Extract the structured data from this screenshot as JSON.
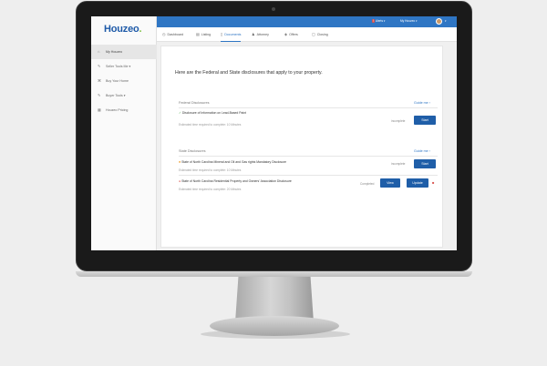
{
  "app": {
    "logo_main": "Houzeo",
    "logo_suffix": "."
  },
  "topbar": {
    "alerts_badge": "!",
    "alerts_label": "Alerts ▾",
    "myhouzeo_label": "My Houzeo ▾",
    "user_caret": "▾"
  },
  "sidebar": {
    "items": [
      {
        "label": "My Houzeo",
        "icon": "home-icon",
        "glyph": "⌂"
      },
      {
        "label": "Seller Tools Me ▾",
        "icon": "tools-icon",
        "glyph": "✎"
      },
      {
        "label": "Buy Your Home",
        "icon": "cart-icon",
        "glyph": "⌘"
      },
      {
        "label": "Buyer Tools ▾",
        "icon": "tools-icon",
        "glyph": "✎"
      },
      {
        "label": "Houzeo Pricing",
        "icon": "grid-icon",
        "glyph": "▦"
      }
    ]
  },
  "tabs": [
    {
      "label": "Dashboard",
      "glyph": "◷",
      "icon": "dashboard-icon"
    },
    {
      "label": "Listing",
      "glyph": "▤",
      "icon": "listing-icon"
    },
    {
      "label": "Documents",
      "glyph": "▯",
      "icon": "document-icon"
    },
    {
      "label": "Attorney",
      "glyph": "♟",
      "icon": "attorney-icon"
    },
    {
      "label": "Offers",
      "glyph": "◈",
      "icon": "offers-icon"
    },
    {
      "label": "Closing",
      "glyph": "▢",
      "icon": "closing-icon"
    }
  ],
  "main": {
    "heading": "Here are the Federal and State disclosures that apply to your property.",
    "federal": {
      "title": "Federal Disclosures",
      "guide": "Guide me ›",
      "docs": [
        {
          "name": "Disclosure of Information on Lead-Based Paint",
          "mark": "✓",
          "mark_color": "#5cb85c",
          "estimate": "Estimated time required to complete: 10 Minutes",
          "status": "incomplete",
          "button": "Start"
        }
      ]
    },
    "state": {
      "title": "State Disclosures",
      "guide": "Guide me ›",
      "docs": [
        {
          "name": "State of North Carolina Mineral and Oil and Gas rights Mandatory Disclosure",
          "mark": "■",
          "mark_color": "#f0ad4e",
          "estimate": "Estimated time required to complete: 10 Minutes",
          "status": "incomplete",
          "button": "Start"
        },
        {
          "name": "State of North Carolina Residential Property and Owners' Association Disclosure",
          "mark": "●",
          "mark_color": "#d9534f",
          "estimate": "Estimated time required to complete: 20 Minutes",
          "status": "Completed",
          "button_view": "View",
          "button_update": "Update"
        }
      ]
    }
  },
  "colors": {
    "accent": "#2f76c4",
    "button": "#1f5ea8",
    "danger": "#d9534f"
  }
}
